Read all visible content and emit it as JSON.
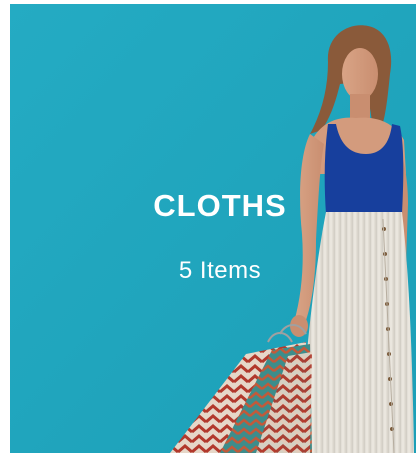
{
  "category_card": {
    "title": "CLOTHS",
    "item_count": "5 Items",
    "colors": {
      "background": "#21a7bf",
      "top": "#173f9d",
      "skirt": "#e8e4dc"
    },
    "image": "woman-with-shopping-bags-photo"
  }
}
